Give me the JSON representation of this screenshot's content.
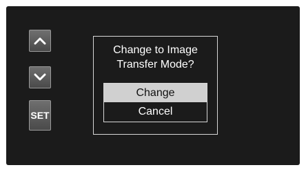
{
  "buttons": {
    "up_icon": "chevron-up-icon",
    "down_icon": "chevron-down-icon",
    "set_label": "SET"
  },
  "dialog": {
    "title_line1": "Change to Image",
    "title_line2": "Transfer Mode?",
    "options": [
      {
        "label": "Change",
        "selected": true
      },
      {
        "label": "Cancel",
        "selected": false
      }
    ],
    "selected_color": "#d0d0d0"
  }
}
